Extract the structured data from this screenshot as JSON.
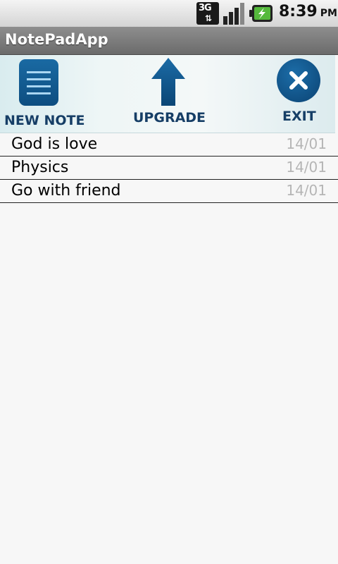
{
  "status_bar": {
    "network_type": "3G",
    "time": "8:39",
    "ampm": "PM"
  },
  "app": {
    "title": "NotePadApp"
  },
  "toolbar": {
    "new_note_label": "NEW NOTE",
    "upgrade_label": "UPGRADE",
    "exit_label": "EXIT"
  },
  "notes": [
    {
      "title": "God is love",
      "date": "14/01"
    },
    {
      "title": "Physics",
      "date": "14/01"
    },
    {
      "title": "Go with friend",
      "date": "14/01"
    }
  ],
  "colors": {
    "toolbar_icon_blue": "#0d4d80",
    "toolbar_label_blue": "#163e66",
    "date_gray": "#b5b5b5"
  }
}
